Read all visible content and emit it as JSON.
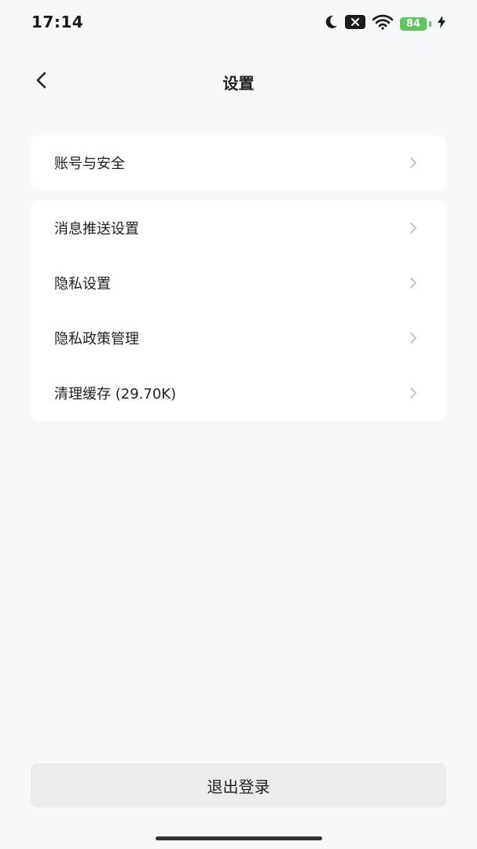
{
  "status_bar": {
    "time": "17:14",
    "battery": "84",
    "icons": [
      "moon-icon",
      "notification-close-icon",
      "wifi-icon",
      "battery-icon",
      "charging-bolt-icon"
    ]
  },
  "header": {
    "title": "设置",
    "back_icon": "chevron-left-icon"
  },
  "sections": [
    {
      "items": [
        {
          "label": "账号与安全"
        }
      ]
    },
    {
      "items": [
        {
          "label": "消息推送设置"
        },
        {
          "label": "隐私设置"
        },
        {
          "label": "隐私政策管理"
        },
        {
          "label": "清理缓存 (29.70K)"
        }
      ]
    }
  ],
  "logout": {
    "label": "退出登录"
  },
  "colors": {
    "background": "#f7f8fa",
    "card": "#ffffff",
    "battery": "#5cc55c",
    "chevron": "#bbbbbb",
    "logout_bg": "#ececee"
  }
}
